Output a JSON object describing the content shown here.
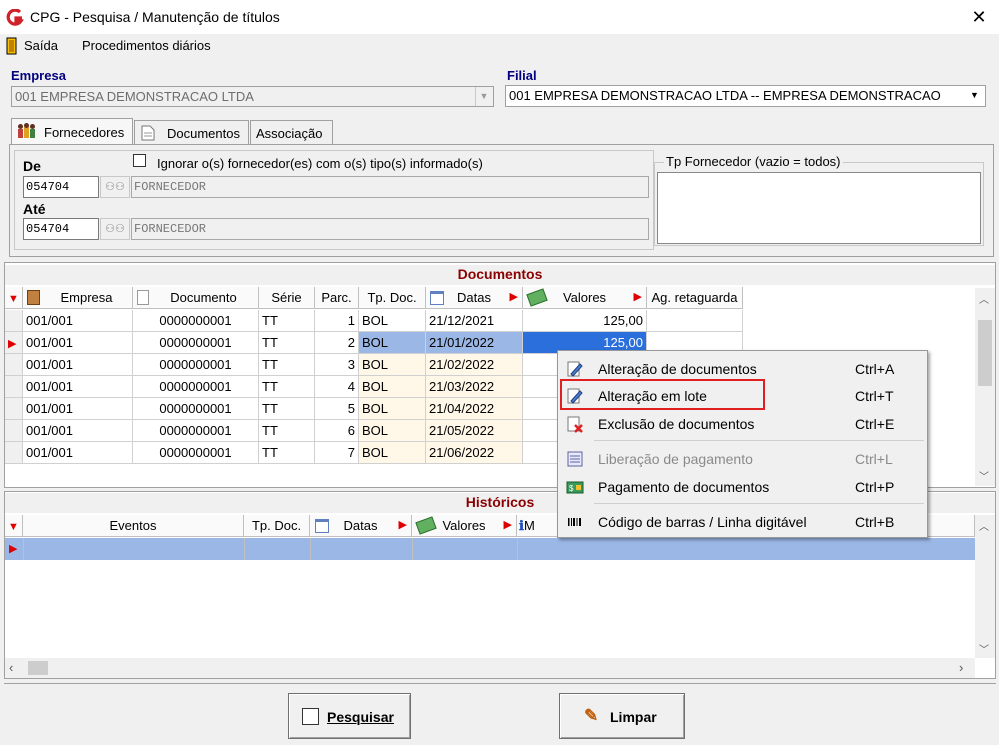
{
  "window": {
    "title": "CPG - Pesquisa / Manutenção de títulos",
    "close_glyph": "✕"
  },
  "menu": {
    "items": [
      "Saída",
      "Procedimentos diários"
    ]
  },
  "empresa": {
    "label": "Empresa",
    "value": "001 EMPRESA DEMONSTRACAO LTDA"
  },
  "filial": {
    "label": "Filial",
    "value": "001 EMPRESA DEMONSTRACAO LTDA -- EMPRESA DEMONSTRACAO"
  },
  "tabs": [
    {
      "label": "Fornecedores",
      "icon": "suppliers-icon",
      "active": true
    },
    {
      "label": "Documentos",
      "icon": "document-icon",
      "active": false
    },
    {
      "label": "Associação",
      "icon": "",
      "active": false
    }
  ],
  "fornecedores": {
    "de_label": "De",
    "ate_label": "Até",
    "de_code": "054704",
    "de_name": "FORNECEDOR",
    "ate_code": "054704",
    "ate_name": "FORNECEDOR",
    "ignore_checkbox_label": "Ignorar o(s) fornecedor(es) com o(s) tipo(s) informado(s)",
    "ignore_checked": false,
    "tipo_group_label": "Tp Fornecedor (vazio = todos)"
  },
  "documentos": {
    "title": "Documentos",
    "columns": [
      "Empresa",
      "Documento",
      "Série",
      "Parc.",
      "Tp. Doc.",
      "Datas",
      "Valores",
      "Ag. retaguarda"
    ],
    "rows": [
      {
        "empresa": "001/001",
        "documento": "0000000001",
        "serie": "TT",
        "parc": "1",
        "tp_doc": "BOL",
        "data": "21/12/2021",
        "valor": "125,00"
      },
      {
        "empresa": "001/001",
        "documento": "0000000001",
        "serie": "TT",
        "parc": "2",
        "tp_doc": "BOL",
        "data": "21/01/2022",
        "valor": "125,00"
      },
      {
        "empresa": "001/001",
        "documento": "0000000001",
        "serie": "TT",
        "parc": "3",
        "tp_doc": "BOL",
        "data": "21/02/2022",
        "valor": ""
      },
      {
        "empresa": "001/001",
        "documento": "0000000001",
        "serie": "TT",
        "parc": "4",
        "tp_doc": "BOL",
        "data": "21/03/2022",
        "valor": ""
      },
      {
        "empresa": "001/001",
        "documento": "0000000001",
        "serie": "TT",
        "parc": "5",
        "tp_doc": "BOL",
        "data": "21/04/2022",
        "valor": ""
      },
      {
        "empresa": "001/001",
        "documento": "0000000001",
        "serie": "TT",
        "parc": "6",
        "tp_doc": "BOL",
        "data": "21/05/2022",
        "valor": ""
      },
      {
        "empresa": "001/001",
        "documento": "0000000001",
        "serie": "TT",
        "parc": "7",
        "tp_doc": "BOL",
        "data": "21/06/2022",
        "valor": ""
      }
    ],
    "selected_row": 1
  },
  "historicos": {
    "title": "Históricos",
    "columns": [
      "Eventos",
      "Tp. Doc.",
      "Datas",
      "Valores",
      "M"
    ]
  },
  "context_menu": {
    "items": [
      {
        "label": "Alteração de documentos",
        "shortcut": "Ctrl+A",
        "icon": "edit-document-icon",
        "enabled": true
      },
      {
        "label": "Alteração em lote",
        "shortcut": "Ctrl+T",
        "icon": "edit-batch-icon",
        "enabled": true,
        "highlighted": true
      },
      {
        "label": "Exclusão de documentos",
        "shortcut": "Ctrl+E",
        "icon": "delete-document-icon",
        "enabled": true
      },
      {
        "label": "Liberação de pagamento",
        "shortcut": "Ctrl+L",
        "icon": "release-payment-icon",
        "enabled": false
      },
      {
        "label": "Pagamento de documentos",
        "shortcut": "Ctrl+P",
        "icon": "payment-icon",
        "enabled": true
      },
      {
        "label": "Código de barras / Linha digitável",
        "shortcut": "Ctrl+B",
        "icon": "barcode-icon",
        "enabled": true
      }
    ]
  },
  "buttons": {
    "pesquisar": "Pesquisar",
    "limpar": "Limpar"
  },
  "colors": {
    "header_red": "#8b0000",
    "label_blue": "#000080",
    "selection_blue": "#9bb7e6",
    "highlight_red": "#e02020",
    "odd_row_tint": "#fff7e8"
  }
}
